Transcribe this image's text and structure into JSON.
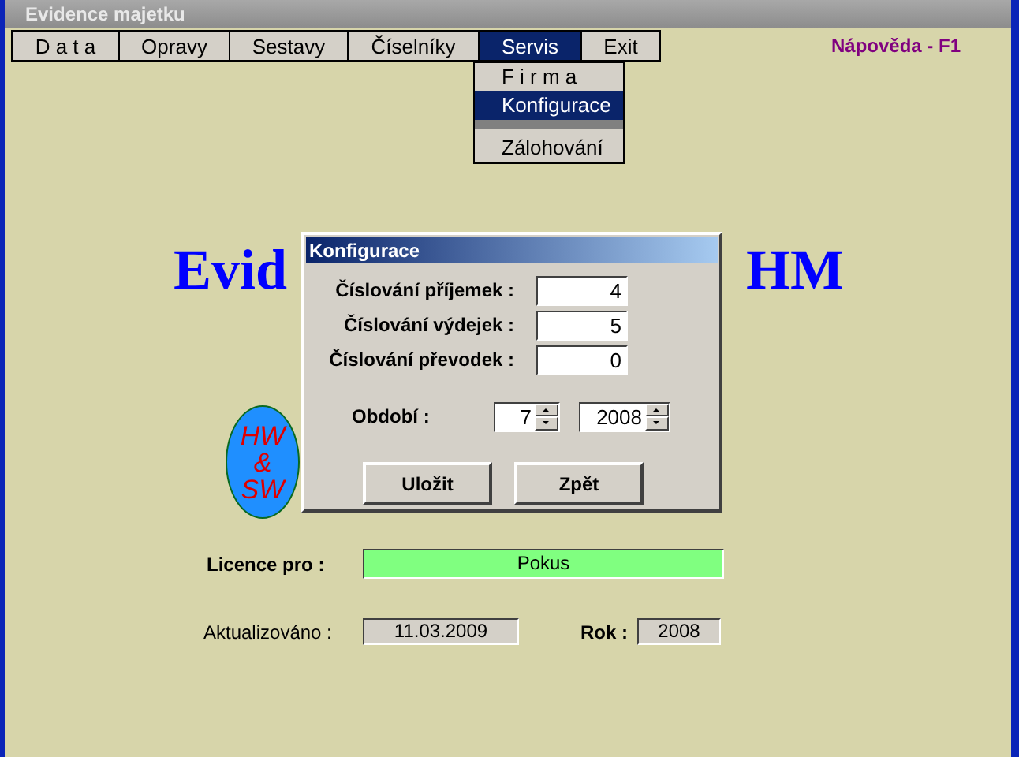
{
  "window": {
    "title": "Evidence majetku"
  },
  "menu": [
    {
      "label": "D a t a",
      "selected": false
    },
    {
      "label": "Opravy",
      "selected": false
    },
    {
      "label": "Sestavy",
      "selected": false
    },
    {
      "label": "Číselníky",
      "selected": false
    },
    {
      "label": "Servis",
      "selected": true
    },
    {
      "label": "Exit",
      "selected": false
    }
  ],
  "help": "Nápověda - F1",
  "dropdown": [
    {
      "kind": "item",
      "label": "F i r m a",
      "selected": false
    },
    {
      "kind": "item",
      "label": "Konfigurace",
      "selected": true
    },
    {
      "kind": "separator"
    },
    {
      "kind": "item",
      "label": "Zálohování",
      "selected": false
    }
  ],
  "heading_left": "Evid",
  "heading_right": "HM",
  "logo": [
    "HW",
    "&",
    "SW"
  ],
  "dialog": {
    "title": "Konfigurace",
    "fields": [
      {
        "label": "Číslování příjemek :",
        "value": "4"
      },
      {
        "label": "Číslování výdejek :",
        "value": "5"
      },
      {
        "label": "Číslování převodek :",
        "value": "0"
      }
    ],
    "period": {
      "label": "Období :",
      "month": "7",
      "year": "2008"
    },
    "buttons": [
      "Uložit",
      "Zpět"
    ]
  },
  "licence": {
    "label": "Licence pro :",
    "value": "Pokus"
  },
  "updated": {
    "label": "Aktualizováno :",
    "value": "11.03.2009"
  },
  "year": {
    "label": "Rok :",
    "value": "2008"
  }
}
